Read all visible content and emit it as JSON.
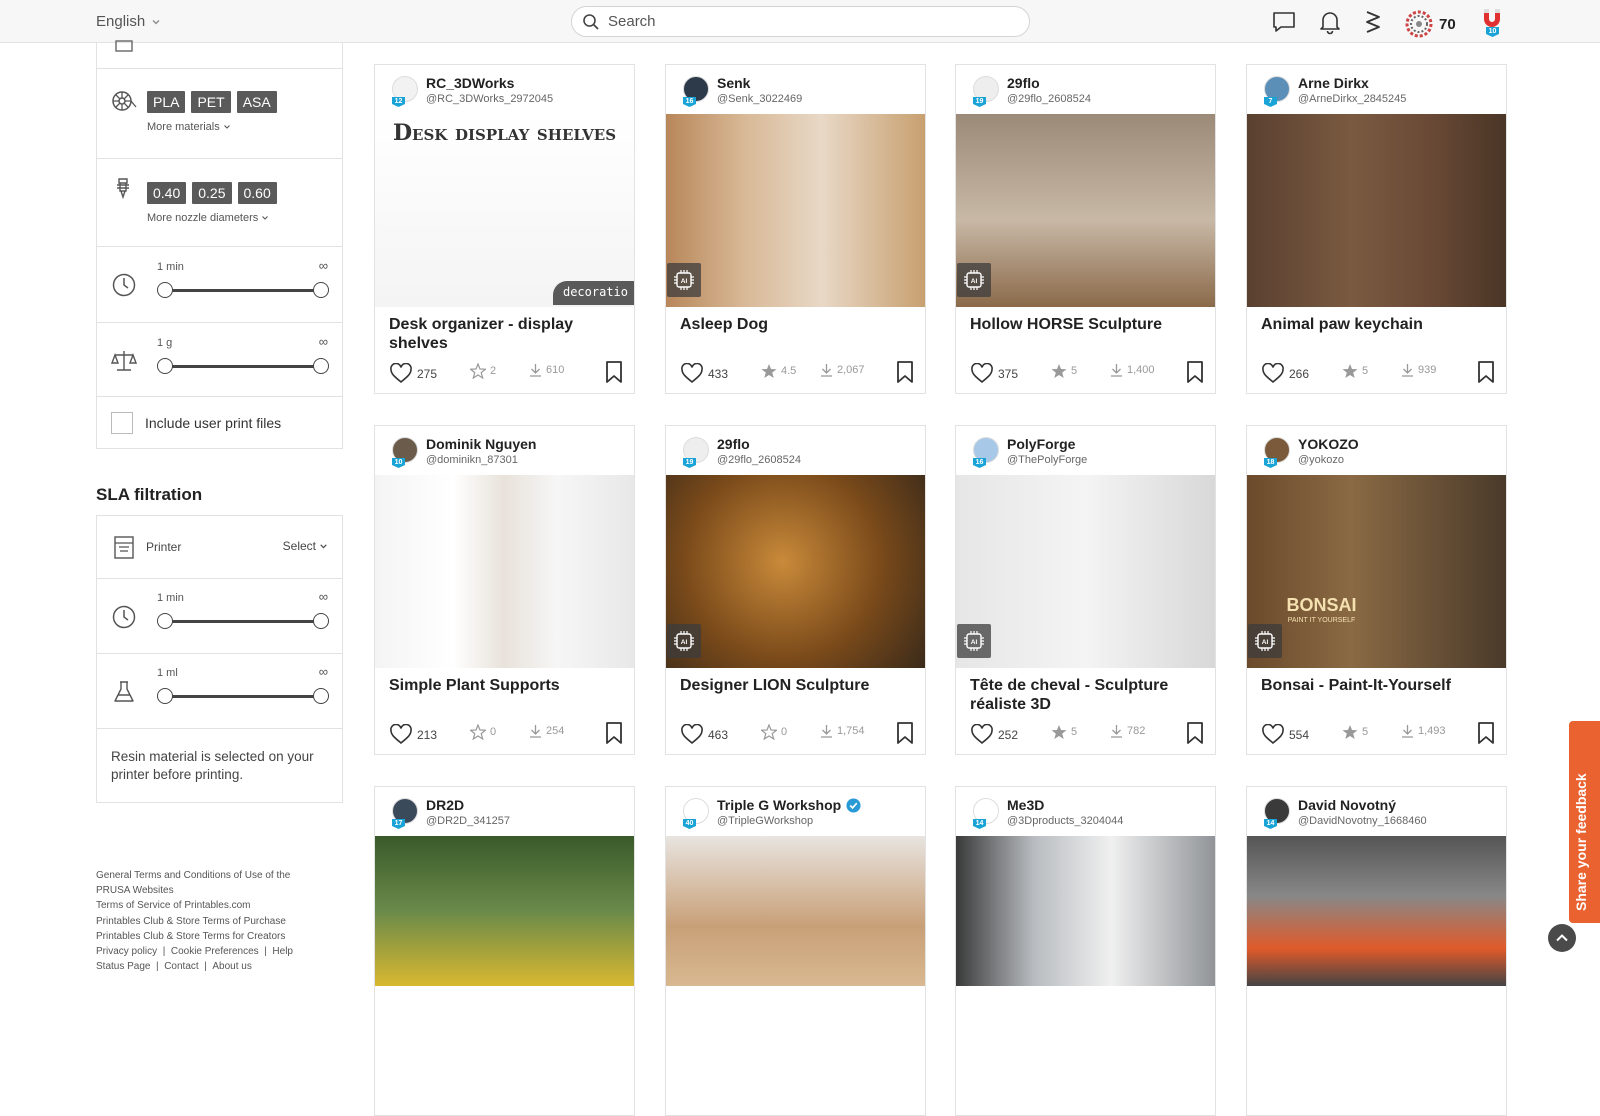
{
  "topbar": {
    "language": "English",
    "search_placeholder": "Search",
    "points": "70",
    "badge_level": "10"
  },
  "sidebar": {
    "materials": [
      "PLA",
      "PET",
      "ASA"
    ],
    "more_materials": "More materials",
    "nozzles": [
      "0.40",
      "0.25",
      "0.60"
    ],
    "more_nozzles": "More nozzle diameters",
    "print_time": {
      "min_label": "1 min",
      "max_label": "∞"
    },
    "weight": {
      "min_label": "1 g",
      "max_label": "∞"
    },
    "include_user_prints": "Include user print files",
    "sla_title": "SLA filtration",
    "printer_label": "Printer",
    "printer_select": "Select",
    "sla_time": {
      "min_label": "1 min",
      "max_label": "∞"
    },
    "sla_volume": {
      "min_label": "1 ml",
      "max_label": "∞"
    },
    "resin_note": "Resin material is selected on your printer before printing."
  },
  "footer": {
    "line1": "General Terms and Conditions of Use of the PRUSA Websites",
    "line2": "Terms of Service of Printables.com",
    "line3": "Printables Club & Store Terms of Purchase",
    "line4": "Printables Club & Store Terms for Creators",
    "privacy": "Privacy policy",
    "cookies": "Cookie Preferences",
    "help": "Help",
    "status": "Status Page",
    "contact": "Contact",
    "about": "About us"
  },
  "cards": [
    {
      "user": "RC_3DWorks",
      "handle": "@RC_3DWorks_2972045",
      "level": "12",
      "title": "Desk organizer - display shelves",
      "likes": "275",
      "rating": "2",
      "downloads": "610",
      "ai": false,
      "img_text": "Desk display shelves",
      "img_tag": "decoratio"
    },
    {
      "user": "Senk",
      "handle": "@Senk_3022469",
      "level": "16",
      "title": "Asleep Dog",
      "likes": "433",
      "rating": "4.5",
      "downloads": "2,067",
      "ai": true
    },
    {
      "user": "29flo",
      "handle": "@29flo_2608524",
      "level": "19",
      "title": "Hollow HORSE Sculpture",
      "likes": "375",
      "rating": "5",
      "downloads": "1,400",
      "ai": true
    },
    {
      "user": "Arne Dirkx",
      "handle": "@ArneDirkx_2845245",
      "level": "7",
      "title": "Animal paw keychain",
      "likes": "266",
      "rating": "5",
      "downloads": "939",
      "ai": false
    },
    {
      "user": "Dominik Nguyen",
      "handle": "@dominikn_87301",
      "level": "10",
      "title": "Simple Plant Supports",
      "likes": "213",
      "rating": "0",
      "downloads": "254",
      "ai": false
    },
    {
      "user": "29flo",
      "handle": "@29flo_2608524",
      "level": "19",
      "title": "Designer LION Sculpture",
      "likes": "463",
      "rating": "0",
      "downloads": "1,754",
      "ai": true
    },
    {
      "user": "PolyForge",
      "handle": "@ThePolyForge",
      "level": "16",
      "title": "Tête de cheval - Sculpture réaliste 3D",
      "likes": "252",
      "rating": "5",
      "downloads": "782",
      "ai": true
    },
    {
      "user": "YOKOZO",
      "handle": "@yokozo",
      "level": "18",
      "title": "Bonsai - Paint-It-Yourself",
      "likes": "554",
      "rating": "5",
      "downloads": "1,493",
      "ai": true,
      "img_text": "BONSAI",
      "img_subtext": "PAINT IT YOURSELF"
    },
    {
      "user": "DR2D",
      "handle": "@DR2D_341257",
      "level": "17",
      "title": "",
      "ai": false
    },
    {
      "user": "Triple G Workshop",
      "handle": "@TripleGWorkshop",
      "level": "40",
      "title": "",
      "ai": false,
      "verified": true
    },
    {
      "user": "Me3D",
      "handle": "@3Dproducts_3204044",
      "level": "14",
      "title": "",
      "ai": false
    },
    {
      "user": "David Novotný",
      "handle": "@DavidNovotny_1668460",
      "level": "14",
      "title": "",
      "ai": false
    }
  ],
  "feedback": "Share your feedback",
  "colors": {
    "accent": "#e9622f",
    "level_badge": "#1aa3d6",
    "chip": "#5a5a5a"
  }
}
